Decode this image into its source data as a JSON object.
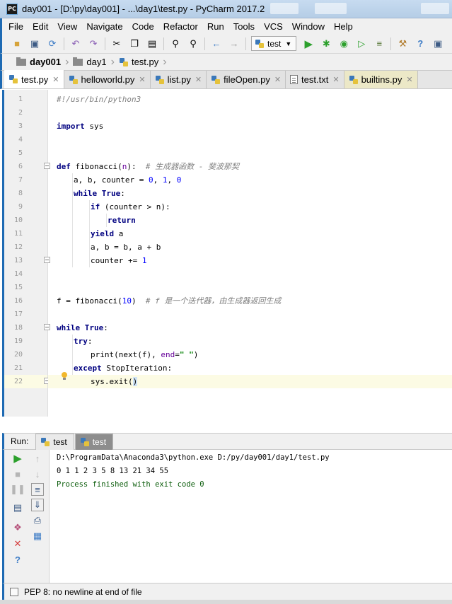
{
  "window": {
    "title": "day001 - [D:\\py\\day001] - ...\\day1\\test.py - PyCharm 2017.2",
    "app_icon_text": "PC"
  },
  "menu": [
    "File",
    "Edit",
    "View",
    "Navigate",
    "Code",
    "Refactor",
    "Run",
    "Tools",
    "VCS",
    "Window",
    "Help"
  ],
  "toolbar": {
    "run_config": "test"
  },
  "breadcrumb": [
    "day001",
    "day1",
    "test.py"
  ],
  "tabs": [
    {
      "label": "test.py",
      "active": true,
      "type": "py"
    },
    {
      "label": "helloworld.py",
      "active": false,
      "type": "py"
    },
    {
      "label": "list.py",
      "active": false,
      "type": "py"
    },
    {
      "label": "fileOpen.py",
      "active": false,
      "type": "py"
    },
    {
      "label": "test.txt",
      "active": false,
      "type": "txt"
    },
    {
      "label": "builtins.py",
      "active": false,
      "type": "py"
    }
  ],
  "editor": {
    "line_numbers": [
      "1",
      "2",
      "3",
      "4",
      "5",
      "6",
      "7",
      "8",
      "9",
      "10",
      "11",
      "12",
      "13",
      "14",
      "15",
      "16",
      "17",
      "18",
      "19",
      "20",
      "21",
      "22"
    ],
    "current_line": 22
  },
  "code_text": {
    "l1": "#!/usr/bin/python3",
    "l3_kw": "import",
    "l3_rest": " sys",
    "l6_kw": "def",
    "l6_name": " fibonacci",
    "l6_p1": "(",
    "l6_param": "n",
    "l6_p2": "):  ",
    "l6_cm": "# 生成器函数 - 斐波那契",
    "l7_a": "a, b, counter = ",
    "l7_n0": "0",
    "l7_c1": ", ",
    "l7_n1": "1",
    "l7_c2": ", ",
    "l7_n2": "0",
    "l8_kw1": "while",
    "l8_sp": " ",
    "l8_kw2": "True",
    "l8_colon": ":",
    "l9_kw": "if",
    "l9_rest": " (counter > n):",
    "l10_kw": "return",
    "l11_kw": "yield",
    "l11_rest": " a",
    "l12": "a, b = b, a + b",
    "l13_a": "counter += ",
    "l13_n": "1",
    "l16_a": "f = fibonacci(",
    "l16_n": "10",
    "l16_b": ")  ",
    "l16_cm": "# f 是一个迭代器，由生成器返回生成",
    "l18_kw1": "while",
    "l18_sp": " ",
    "l18_kw2": "True",
    "l18_colon": ":",
    "l19_kw": "try",
    "l19_colon": ":",
    "l20_a": "print(next(f), ",
    "l20_param": "end",
    "l20_eq": "=",
    "l20_str": "\" \"",
    "l20_b": ")",
    "l21_kw": "except",
    "l21_rest": " StopIteration:",
    "l22_a": "sys.exit(",
    "l22_b": ")"
  },
  "run_panel": {
    "label": "Run:",
    "tabs": [
      {
        "label": "test",
        "active": false
      },
      {
        "label": "test",
        "active": true
      }
    ],
    "console": [
      "D:\\ProgramData\\Anaconda3\\python.exe D:/py/day001/day1/test.py",
      "0 1 1 2 3 5 8 13 21 34 55",
      "Process finished with exit code 0"
    ]
  },
  "status": {
    "message": "PEP 8: no newline at end of file"
  }
}
